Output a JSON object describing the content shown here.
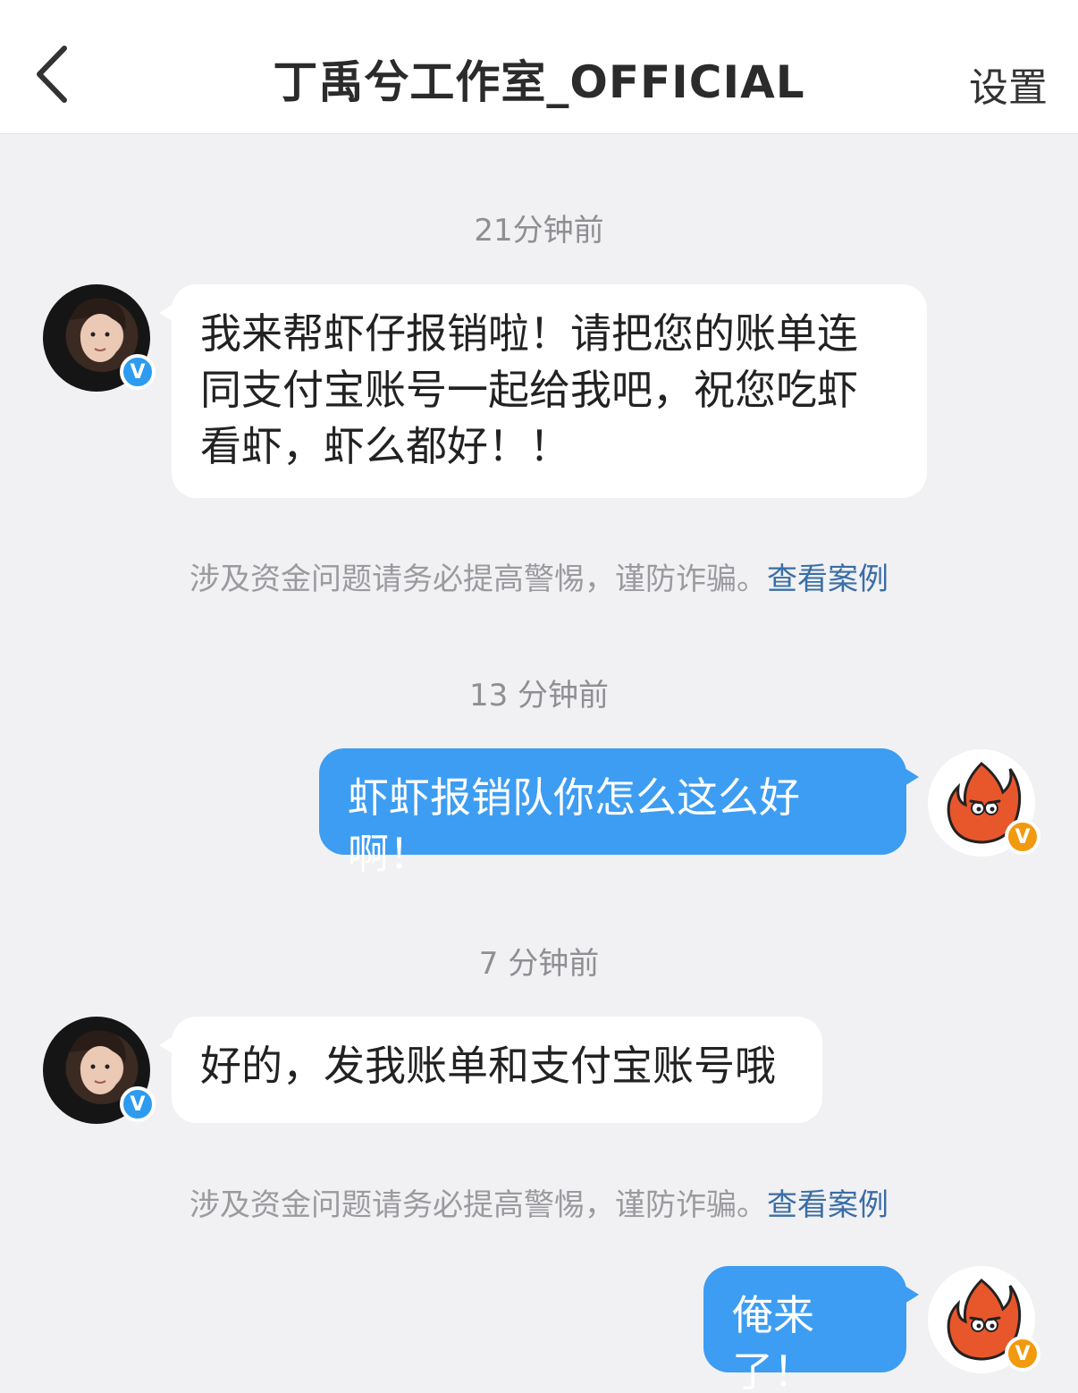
{
  "header": {
    "title": "丁禹兮工作室_OFFICIAL",
    "settings_label": "设置"
  },
  "colors": {
    "right_bubble": "#3d9df2",
    "link": "#3a6ea5",
    "verified_blue": "#2d9bf0",
    "verified_orange": "#f29a0e"
  },
  "messages": [
    {
      "time": "21分钟前",
      "side": "left",
      "text": "我来帮虾仔报销啦！请把您的账单连同支付宝账号一起给我吧，祝您吃虾看虾，虾么都好！！",
      "warning": "涉及资金问题请务必提高警惕，谨防诈骗。",
      "warning_link": "查看案例"
    },
    {
      "time": "13 分钟前",
      "side": "right",
      "text": "虾虾报销队你怎么这么好啊！"
    },
    {
      "time": "7 分钟前",
      "side": "left",
      "text": "好的，发我账单和支付宝账号哦",
      "warning": "涉及资金问题请务必提高警惕，谨防诈骗。",
      "warning_link": "查看案例"
    },
    {
      "side": "right",
      "text": "俺来了！"
    }
  ],
  "badges": {
    "verified": "V"
  },
  "icons": {
    "back": "chevron-left-icon",
    "peer_avatar": "user-avatar",
    "self_avatar": "fire-mascot-avatar"
  }
}
